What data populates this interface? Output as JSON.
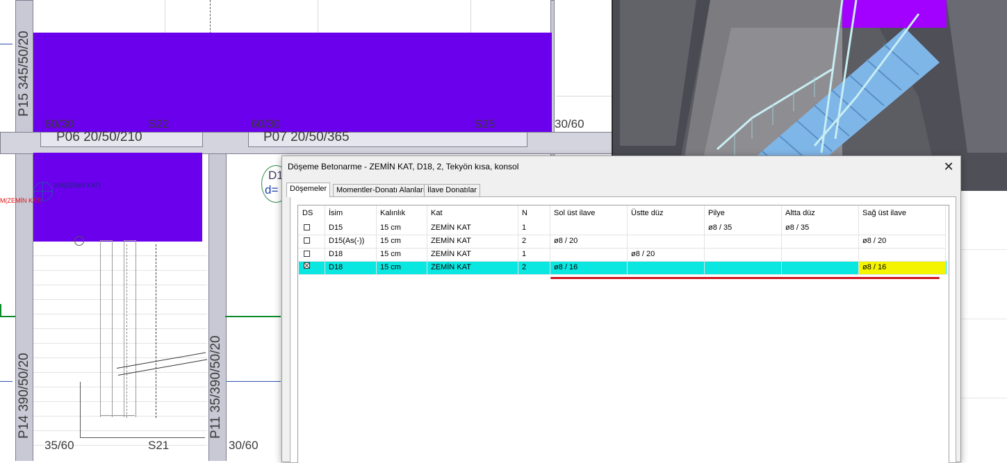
{
  "cad": {
    "labels": {
      "p15": "P15 345/50/20",
      "s22": "S22",
      "s25": "S25",
      "beam_left_end": "60/30",
      "beam_mid_end": "60/30",
      "beam_right_end": "30/60",
      "p06": "P06 20/50/210",
      "p07": "P07 20/50/365",
      "km_zemin": "KM(ZEMİN KAT)",
      "km_zemin_red": "M(ZEMİN KAT)",
      "slab_d1": "D1",
      "slab_d_eq": "d=",
      "p14": "P14 390/50/20",
      "p11": "P11 35/390/50/20",
      "bottom_left": "35/60",
      "s21": "S21",
      "bottom_right": "30/60"
    },
    "colors": {
      "slab": "#6a00ec",
      "beam": "#c9c9d6",
      "green_axis": "#0a8a2a"
    }
  },
  "dialog": {
    "title": "Döşeme Betonarme - ZEMİN KAT, D18, 2, Tekyön kısa, konsol",
    "close_label": "✕",
    "tabs": [
      {
        "label": "Döşemeler",
        "active": true
      },
      {
        "label": "Momentler-Donatı Alanları",
        "active": false
      },
      {
        "label": "İlave Donatılar",
        "active": false
      }
    ],
    "grid": {
      "columns": [
        "DS",
        "İsim",
        "Kalınlık",
        "Kat",
        "N",
        "Sol üst ilave",
        "Üstte düz",
        "Pilye",
        "Altta düz",
        "Sağ üst ilave"
      ],
      "rows": [
        {
          "checked": false,
          "isim": "D15",
          "kalinlik": "15 cm",
          "kat": "ZEMİN KAT",
          "n": "1",
          "sol_ust_ilave": "",
          "ustte_duz": "",
          "pilye": "ø8 / 35",
          "altta_duz": "ø8 / 35",
          "sag_ust_ilave": ""
        },
        {
          "checked": false,
          "isim": "D15(As(-))",
          "kalinlik": "15 cm",
          "kat": "ZEMİN KAT",
          "n": "2",
          "sol_ust_ilave": "ø8 / 20",
          "ustte_duz": "",
          "pilye": "",
          "altta_duz": "",
          "sag_ust_ilave": "ø8 / 20"
        },
        {
          "checked": false,
          "isim": "D18",
          "kalinlik": "15 cm",
          "kat": "ZEMİN KAT",
          "n": "1",
          "sol_ust_ilave": "",
          "ustte_duz": "ø8 / 20",
          "pilye": "",
          "altta_duz": "",
          "sag_ust_ilave": ""
        },
        {
          "checked": true,
          "isim": "D18",
          "kalinlik": "15 cm",
          "kat": "ZEMİN KAT",
          "n": "2",
          "sol_ust_ilave": "ø8 / 16",
          "ustte_duz": "",
          "pilye": "",
          "altta_duz": "",
          "sag_ust_ilave": "ø8 / 16"
        }
      ],
      "selected_row_index": 3,
      "colors": {
        "selected_row": "#0ae6e0",
        "highlight_cell": "#f4f400",
        "annotation_line": "#d0121b"
      }
    }
  }
}
